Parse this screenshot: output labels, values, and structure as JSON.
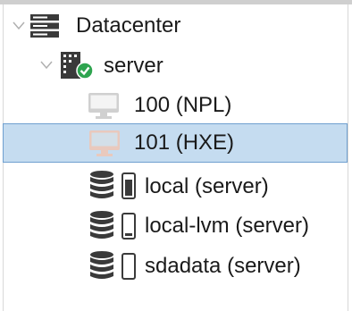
{
  "tree": {
    "datacenter": {
      "label": "Datacenter",
      "icon": "datacenter-icon",
      "expanded": true
    },
    "node": {
      "label": "server",
      "icon": "server-online-icon",
      "status_color": "#2ea44f",
      "expanded": true
    },
    "guests": [
      {
        "label": "100 (NPL)",
        "icon": "vm-monitor-icon",
        "selected": false
      },
      {
        "label": "101 (HXE)",
        "icon": "vm-monitor-icon",
        "selected": true
      }
    ],
    "storages": [
      {
        "label": "local (server)",
        "icon": "storage-icon",
        "usage_fraction": 0.85
      },
      {
        "label": "local-lvm (server)",
        "icon": "storage-icon",
        "usage_fraction": 0.1
      },
      {
        "label": "sdadata (server)",
        "icon": "storage-icon",
        "usage_fraction": 0.0
      }
    ]
  },
  "colors": {
    "selection_bg": "#c5dcf0",
    "selection_border": "#6f9fcf",
    "icon_dark": "#3a3a3a",
    "monitor_gray": "#d0d0d0",
    "monitor_selected": "#f0c8b8"
  }
}
